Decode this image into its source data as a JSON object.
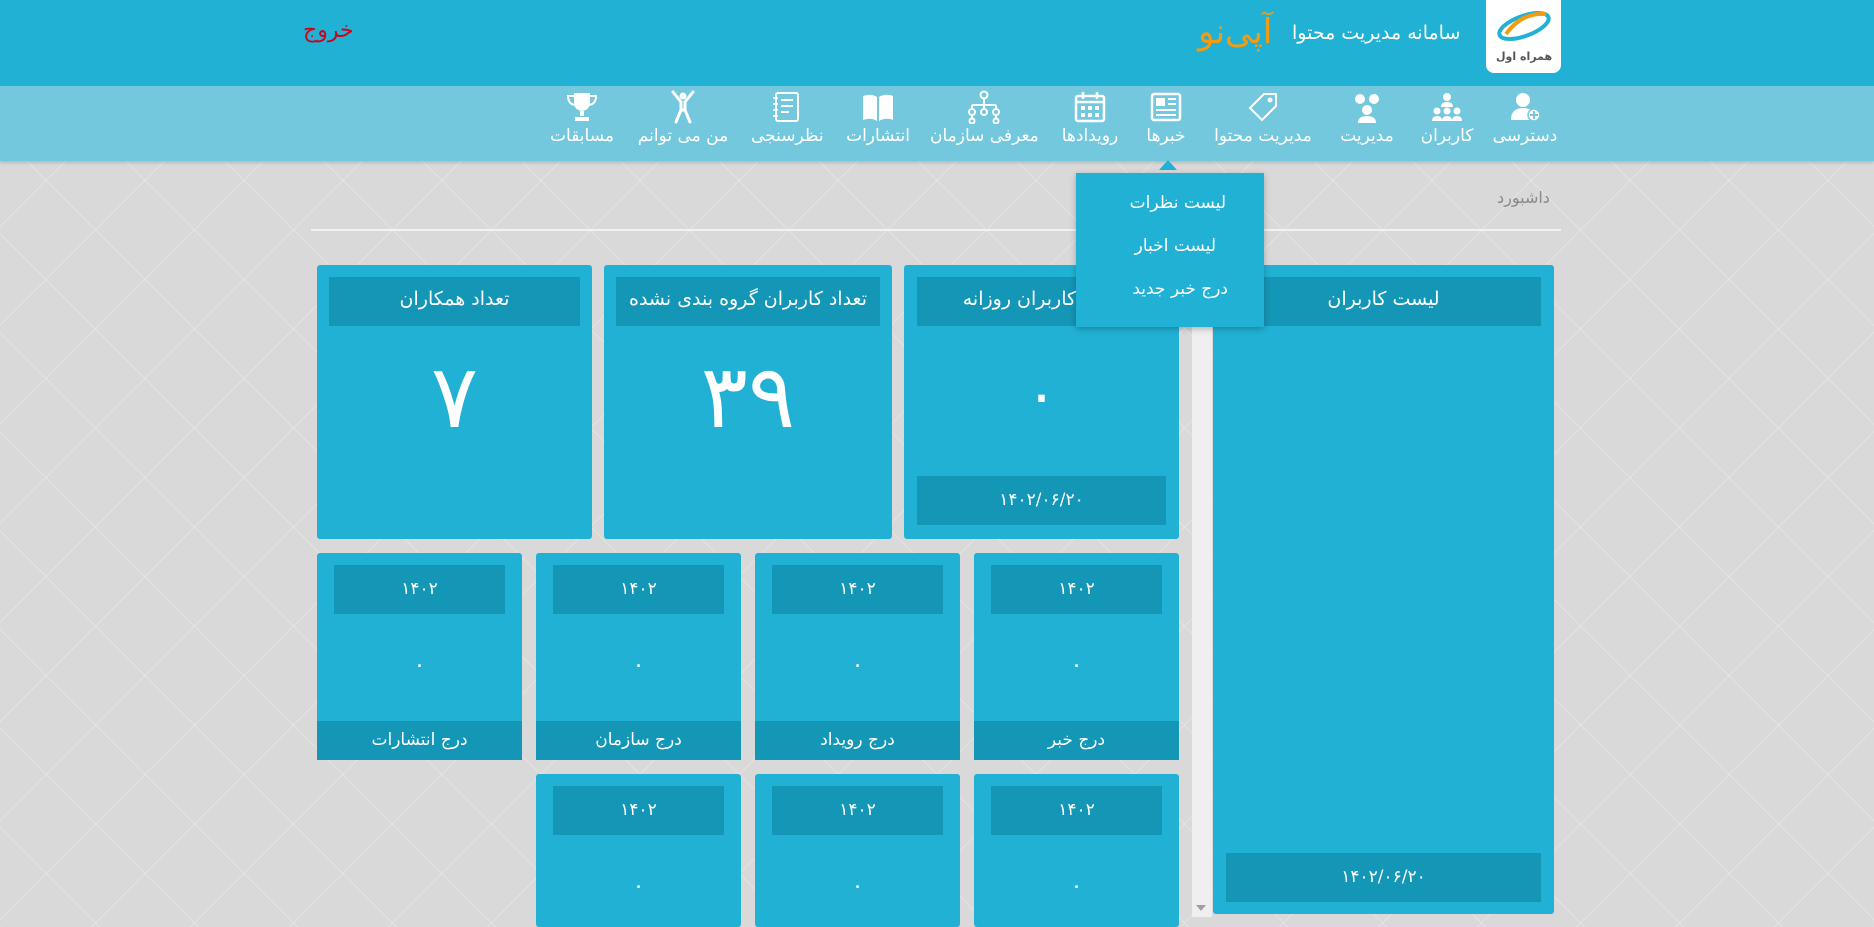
{
  "header": {
    "logo_icon": "hamrahe-aval-logo",
    "logo_text": "همراه اول",
    "site_title": "سامانه مدیریت محتوا",
    "brand": "آپی‌نو",
    "logout": "خروج",
    "colors": {
      "header_bg": "#21b1d4",
      "brand": "#f39c12",
      "logout": "#d0021b"
    }
  },
  "nav": {
    "items": [
      {
        "label": "دسترسی",
        "icon": "user-add-icon"
      },
      {
        "label": "کاربران",
        "icon": "users-hierarchy-icon"
      },
      {
        "label": "مدیریت",
        "icon": "team-icon"
      },
      {
        "label": "مدیریت محتوا",
        "icon": "tag-icon"
      },
      {
        "label": "خبرها",
        "icon": "newspaper-icon"
      },
      {
        "label": "رویدادها",
        "icon": "calendar-icon"
      },
      {
        "label": "معرفی سازمان",
        "icon": "org-chart-icon"
      },
      {
        "label": "انتشارات",
        "icon": "book-icon"
      },
      {
        "label": "نظرسنجی",
        "icon": "survey-icon"
      },
      {
        "label": "من می توانم",
        "icon": "person-cheer-icon"
      },
      {
        "label": "مسابقات",
        "icon": "trophy-icon"
      }
    ],
    "active": "خبرها"
  },
  "dropdown": {
    "items": [
      "لیست نظرات",
      "لیست اخبار",
      "درج خبر جدید"
    ]
  },
  "breadcrumb": "داشبورد",
  "tiles": {
    "users_list": {
      "title": "لیست کاربران",
      "date": "۱۴۰۲/۰۶/۲۰"
    },
    "daily_users": {
      "title": "تعداد کاربران روزانه",
      "value": "۰",
      "date": "۱۴۰۲/۰۶/۲۰"
    },
    "ungrouped_users": {
      "title": "تعداد کاربران گروه بندی نشده",
      "value": "۳۹"
    },
    "colleagues": {
      "title": "تعداد همکاران",
      "value": "۷"
    },
    "small_row1": [
      {
        "year": "۱۴۰۲",
        "value": "۰",
        "label": "درج خبر"
      },
      {
        "year": "۱۴۰۲",
        "value": "۰",
        "label": "درج رویداد"
      },
      {
        "year": "۱۴۰۲",
        "value": "۰",
        "label": "درج سازمان"
      },
      {
        "year": "۱۴۰۲",
        "value": "۰",
        "label": "درج انتشارات"
      }
    ],
    "small_row2": [
      {
        "year": "۱۴۰۲",
        "value": "۰"
      },
      {
        "year": "۱۴۰۲",
        "value": "۰"
      },
      {
        "year": "۱۴۰۲",
        "value": "۰"
      }
    ]
  }
}
